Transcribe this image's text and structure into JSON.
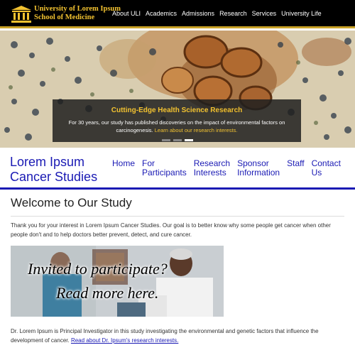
{
  "header": {
    "university_line1": "University of Lorem Ipsum",
    "university_line2": "School of Medicine",
    "nav": [
      "About ULI",
      "Academics",
      "Admissions",
      "Research",
      "Services",
      "University Life"
    ]
  },
  "hero": {
    "title": "Cutting-Edge Health Science Research",
    "text": "For 30 years, our study has published discoveries on the impact of environmental factors on carcinogenesis.",
    "link": "Learn about our research interests.",
    "slides": 3,
    "active_slide": 3
  },
  "site": {
    "title_line1": "Lorem Ipsum",
    "title_line2": "Cancer Studies",
    "nav": [
      "Home",
      "For\nParticipants",
      "Research\nInterests",
      "Sponsor\nInformation",
      "Staff",
      "Contact\nUs"
    ]
  },
  "main": {
    "heading": "Welcome to Our Study",
    "intro": "Thank you for your interest in Lorem Ipsum Cancer Studies. Our goal is to better know why some people get cancer when other people don't and to help doctors better prevent, detect, and cure cancer.",
    "banner_line1": "Invited to participate?",
    "banner_line2": "Read more here.",
    "pi_text": "Dr. Lorem Ipsum is Principal Investigator in this study investigating the environmental and genetic factors that influence the development of cancer.",
    "pi_link": "Read about Dr. Ipsum's research interests."
  },
  "colors": {
    "gold": "#f2c230",
    "blue": "#1a1ab4",
    "black": "#000000"
  }
}
